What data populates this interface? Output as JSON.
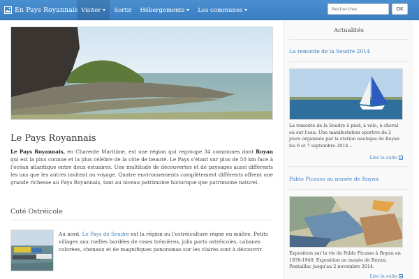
{
  "navbar": {
    "brand": "En Pays Royannais",
    "items": [
      {
        "label": "Visiter",
        "has_caret": true
      },
      {
        "label": "Sortir",
        "has_caret": false
      },
      {
        "label": "Hébergements",
        "has_caret": true
      },
      {
        "label": "Les communes",
        "has_caret": true
      }
    ],
    "search_placeholder": "Rechercher",
    "ok_label": "OK"
  },
  "main": {
    "title": "Le Pays Royannais",
    "intro_parts": {
      "bold1": "Le Pays Royannais,",
      "text1": " en Charente Maritime, est une région qui regroupe 34 communes dont ",
      "bold2": "Royan",
      "text2": " qui est la plus connue et la plus célèbre de la côte de beauté. Le Pays s'étant sur plus de 50 km face à l'océan atlantique entre deux estuaires. Une multitude de découvertes et de paysages aussi différents les uns que les autres invitent au voyage. Quatre environnements complètement différents offrent une grande richesse au Pays Royannais, tant au niveau patrimoine historique que patrimoine naturel."
    },
    "section": {
      "title": "Coté Ostréicole",
      "text_before": "Au nord, ",
      "link": "Le Pays de Seudre",
      "text_after": " est la région ou l'ostréiculture règne en maître. Petits villages aux ruelles bordées de roses trémières, jolis ports ostréicoles, cabanes colorées, chenaux et de magnifiques panoramas sur les claires sont à découvrir."
    }
  },
  "sidebar": {
    "heading": "Actualités",
    "news": [
      {
        "title": "La remonte de la Seudre 2014",
        "text": "La remonte de la Seudre à pied, à vélo, à cheval ou sur l'eau. Une manifestation sportive de 2 jours organisée par la station nautique de Royan les 6 et 7 septembre 2014...",
        "read_more": "Lire la suite"
      },
      {
        "title": "Pablo Picasso au musée de Royan",
        "text": "Exposition sur la vie de Pablo Picasso à Royan en 1939-1940. Exposition au musée de Royan, Pontaillac jusqu'au 2 novembre 2014.",
        "read_more": "Lire la suite"
      }
    ]
  },
  "colors": {
    "navbar": "#3b7fc2",
    "link": "#3b7fc2"
  }
}
